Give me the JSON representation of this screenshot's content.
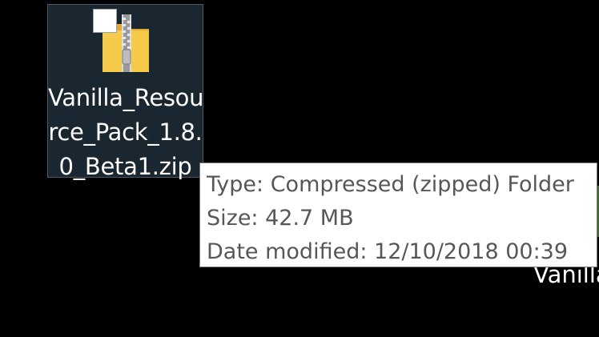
{
  "desktop_item": {
    "label_lines": [
      "Vanilla_Resou",
      "rce_Pack_1.8.",
      "0_Beta1.zip"
    ],
    "icon": "zip-folder-icon",
    "selected": true
  },
  "tooltip": {
    "type": "Type: Compressed (zipped) Folder",
    "size": "Size: 42.7 MB",
    "date_modified": "Date modified: 12/10/2018 00:39"
  },
  "partial_item": {
    "label": "Vanilla"
  },
  "colors": {
    "background": "#000000",
    "selection_fill": "#1b2730",
    "folder_yellow": "#f5c94a",
    "tooltip_text": "#575757"
  }
}
